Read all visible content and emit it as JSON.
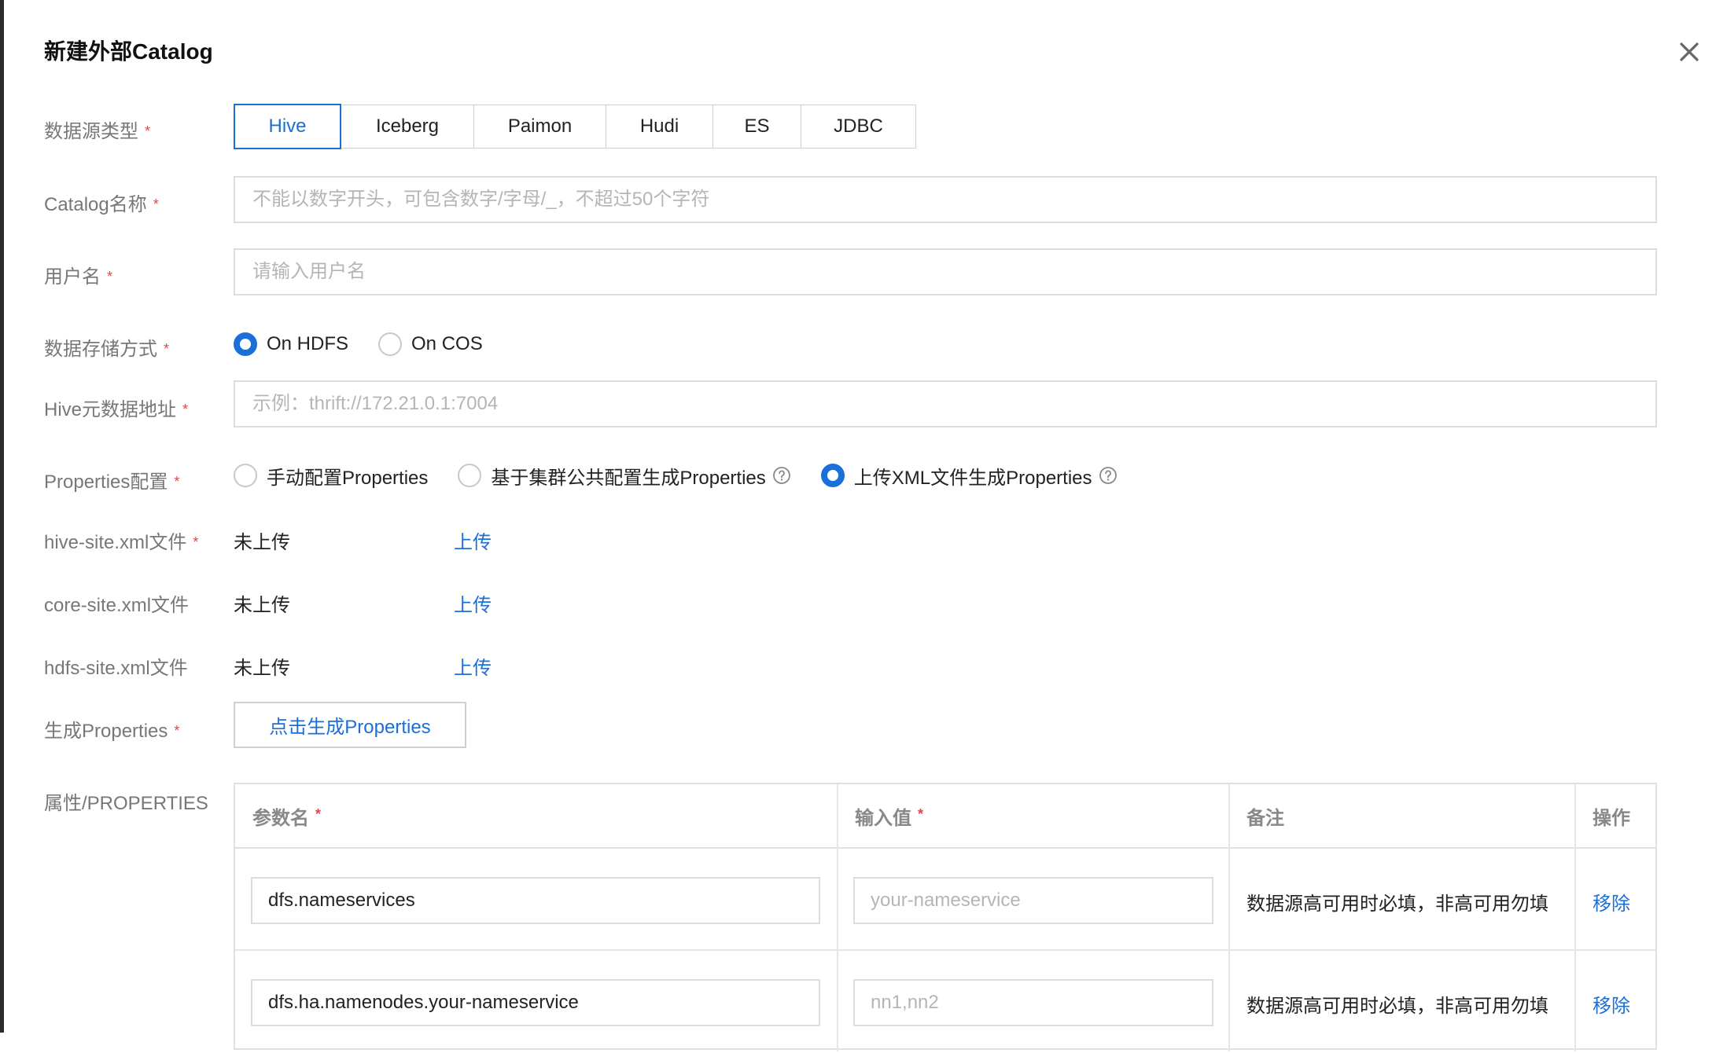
{
  "dialog": {
    "title": "新建外部Catalog"
  },
  "required_mark": "*",
  "form": {
    "datasource_type": {
      "label": "数据源类型",
      "options": [
        "Hive",
        "Iceberg",
        "Paimon",
        "Hudi",
        "ES",
        "JDBC"
      ],
      "selected": "Hive"
    },
    "catalog_name": {
      "label": "Catalog名称",
      "value": "",
      "placeholder": "不能以数字开头，可包含数字/字母/_，不超过50个字符"
    },
    "username": {
      "label": "用户名",
      "value": "",
      "placeholder": "请输入用户名"
    },
    "storage": {
      "label": "数据存储方式",
      "options": [
        "On HDFS",
        "On COS"
      ],
      "selected": "On HDFS"
    },
    "hive_metastore": {
      "label": "Hive元数据地址",
      "value": "",
      "placeholder": "示例：thrift://172.21.0.1:7004"
    },
    "properties_config": {
      "label": "Properties配置",
      "options": [
        "手动配置Properties",
        "基于集群公共配置生成Properties",
        "上传XML文件生成Properties"
      ],
      "selected": "上传XML文件生成Properties"
    },
    "files": [
      {
        "label": "hive-site.xml文件",
        "required": true,
        "status": "未上传",
        "action": "上传"
      },
      {
        "label": "core-site.xml文件",
        "required": false,
        "status": "未上传",
        "action": "上传"
      },
      {
        "label": "hdfs-site.xml文件",
        "required": false,
        "status": "未上传",
        "action": "上传"
      }
    ],
    "generate": {
      "label": "生成Properties",
      "button": "点击生成Properties"
    },
    "properties": {
      "label": "属性/PROPERTIES",
      "headers": {
        "name": "参数名",
        "value": "输入值",
        "remark": "备注",
        "op": "操作"
      },
      "rows": [
        {
          "name": "dfs.nameservices",
          "value": "",
          "placeholder": "your-nameservice",
          "remark": "数据源高可用时必填，非高可用勿填",
          "action": "移除"
        },
        {
          "name": "dfs.ha.namenodes.your-nameservice",
          "value": "",
          "placeholder": "nn1,nn2",
          "remark": "数据源高可用时必填，非高可用勿填",
          "action": "移除"
        }
      ]
    }
  },
  "colors": {
    "accent": "#1a6fd8",
    "required": "#e54545",
    "label": "#777777",
    "border": "#dcdcdc"
  }
}
